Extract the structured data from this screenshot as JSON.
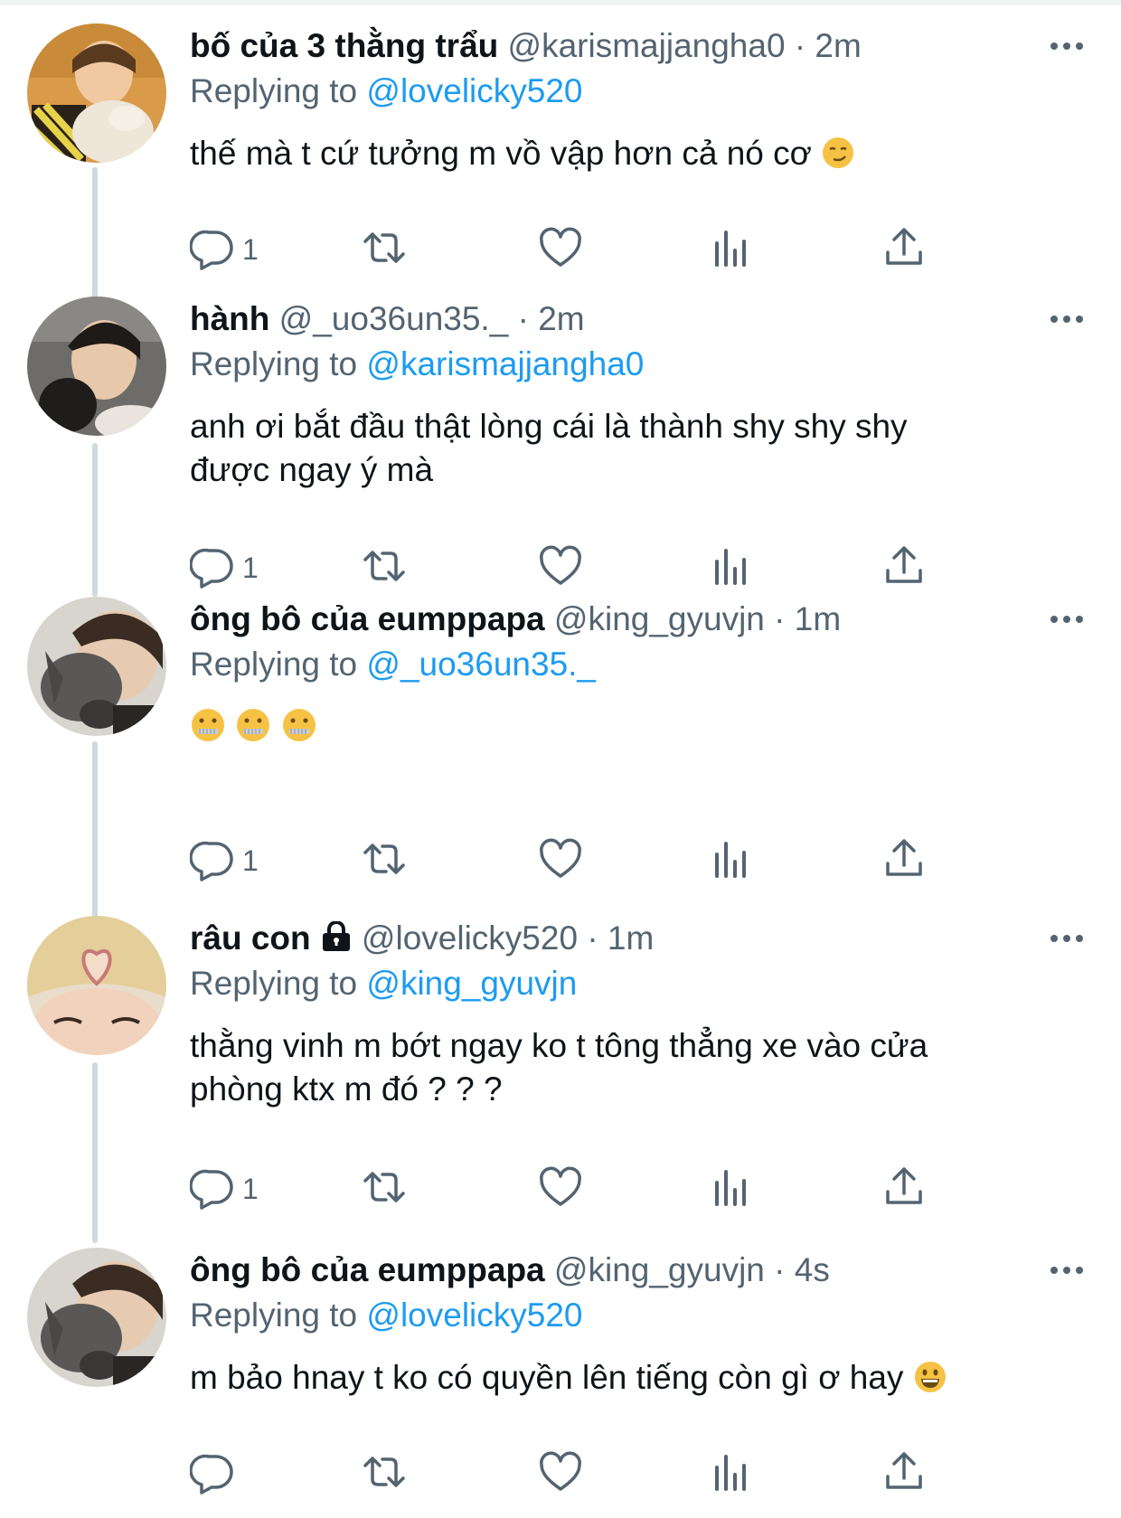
{
  "tweets": [
    {
      "name": "bố của 3 thằng trẩu",
      "handle": "@karismajjangha0",
      "time": "2m",
      "replying_label": "Replying to",
      "replying_to": "@lovelicky520",
      "text": "thế mà t cứ tưởng m vồ vập hơn cả nó cơ",
      "emoji": "smirking-face",
      "reply_count": "1",
      "locked": false
    },
    {
      "name": "hành",
      "handle": "@_uo36un35._",
      "time": "2m",
      "replying_label": "Replying to",
      "replying_to": "@karismajjangha0",
      "text": "anh ơi bắt đầu thật lòng cái là thành shy shy shy được ngay ý mà",
      "emoji": "",
      "reply_count": "1",
      "locked": false
    },
    {
      "name": "ông bô của eumppapa",
      "handle": "@king_gyuvjn",
      "time": "1m",
      "replying_label": "Replying to",
      "replying_to": "@_uo36un35._",
      "text": "",
      "emoji": "zipper-mouth-face x3",
      "reply_count": "1",
      "locked": false
    },
    {
      "name": "râu con",
      "handle": "@lovelicky520",
      "time": "1m",
      "replying_label": "Replying to",
      "replying_to": "@king_gyuvjn",
      "text": "thằng vinh m bớt ngay ko t tông thẳng xe vào cửa phòng ktx m đó ? ? ?",
      "emoji": "",
      "reply_count": "1",
      "locked": true
    },
    {
      "name": "ông bô của eumppapa",
      "handle": "@king_gyuvjn",
      "time": "4s",
      "replying_label": "Replying to",
      "replying_to": "@lovelicky520",
      "text": "m bảo hnay t ko có quyền lên tiếng còn gì ơ hay",
      "emoji": "grinning-face",
      "reply_count": "",
      "locked": false
    }
  ],
  "separator": "·",
  "icons": {
    "reply": "reply-icon",
    "retweet": "retweet-icon",
    "like": "heart-icon",
    "views": "views-icon",
    "share": "share-icon",
    "more": "more-icon",
    "lock": "lock-icon"
  },
  "colors": {
    "link": "#1d9bf0",
    "secondary": "#536471",
    "text": "#0f1419",
    "thread_line": "#cfd9de"
  }
}
